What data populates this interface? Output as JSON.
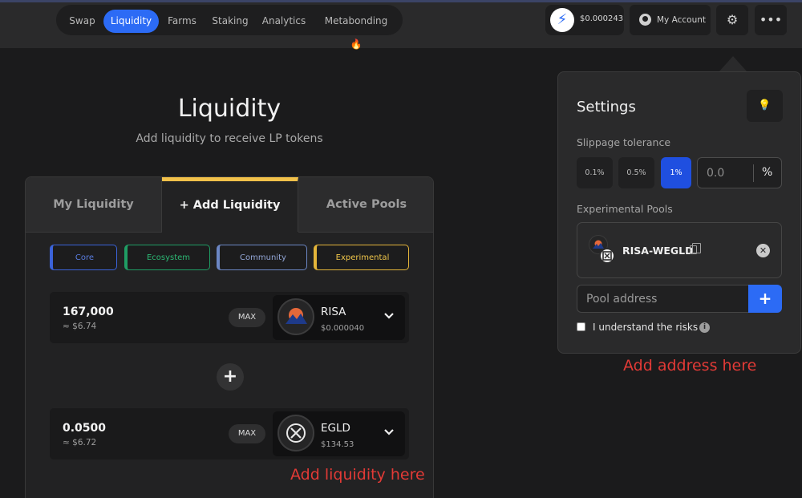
{
  "nav": {
    "items": [
      {
        "label": "Swap"
      },
      {
        "label": "Liquidity",
        "active": true
      },
      {
        "label": "Farms"
      },
      {
        "label": "Staking"
      },
      {
        "label": "Analytics"
      },
      {
        "label": "Metabonding 🔥"
      }
    ]
  },
  "header": {
    "balance": "$0.000243",
    "account_label": "My Account",
    "settings_icon": "gear-icon",
    "more_icon": "more-dots-icon"
  },
  "page": {
    "title": "Liquidity",
    "subtitle": "Add liquidity to receive LP tokens"
  },
  "tabs": [
    {
      "label": "My Liquidity"
    },
    {
      "label": "+ Add Liquidity",
      "active": true
    },
    {
      "label": "Active Pools"
    }
  ],
  "categories": [
    {
      "label": "Core",
      "color": "#3b63d9"
    },
    {
      "label": "Ecosystem",
      "color": "#1f9d64"
    },
    {
      "label": "Community",
      "color": "#6c87c5"
    },
    {
      "label": "Experimental",
      "color": "#e4b53a",
      "active": true
    }
  ],
  "token_a": {
    "amount": "167,000",
    "usd": "≈ $6.74",
    "max_label": "MAX",
    "symbol": "RISA",
    "price": "$0.000040"
  },
  "token_b": {
    "amount": "0.0500",
    "usd": "≈ $6.72",
    "max_label": "MAX",
    "symbol": "EGLD",
    "price": "$134.53"
  },
  "annotations": {
    "add_liquidity": "Add liquidity here",
    "add_address": "Add address here"
  },
  "settings": {
    "title": "Settings",
    "slippage_label": "Slippage tolerance",
    "slippage_options": [
      "0.1%",
      "0.5%",
      "1%"
    ],
    "slippage_selected": "1%",
    "slippage_custom_placeholder": "0.0",
    "percent_sign": "%",
    "experimental_label": "Experimental Pools",
    "pool_name": "RISA-WEGLD",
    "pool_address_placeholder": "Pool address",
    "add_button": "+",
    "risk_label": "I understand the risks"
  },
  "colors": {
    "accent": "#2c6bf5",
    "tab_highlight": "#f2c14a",
    "annotation": "#e23a36"
  }
}
